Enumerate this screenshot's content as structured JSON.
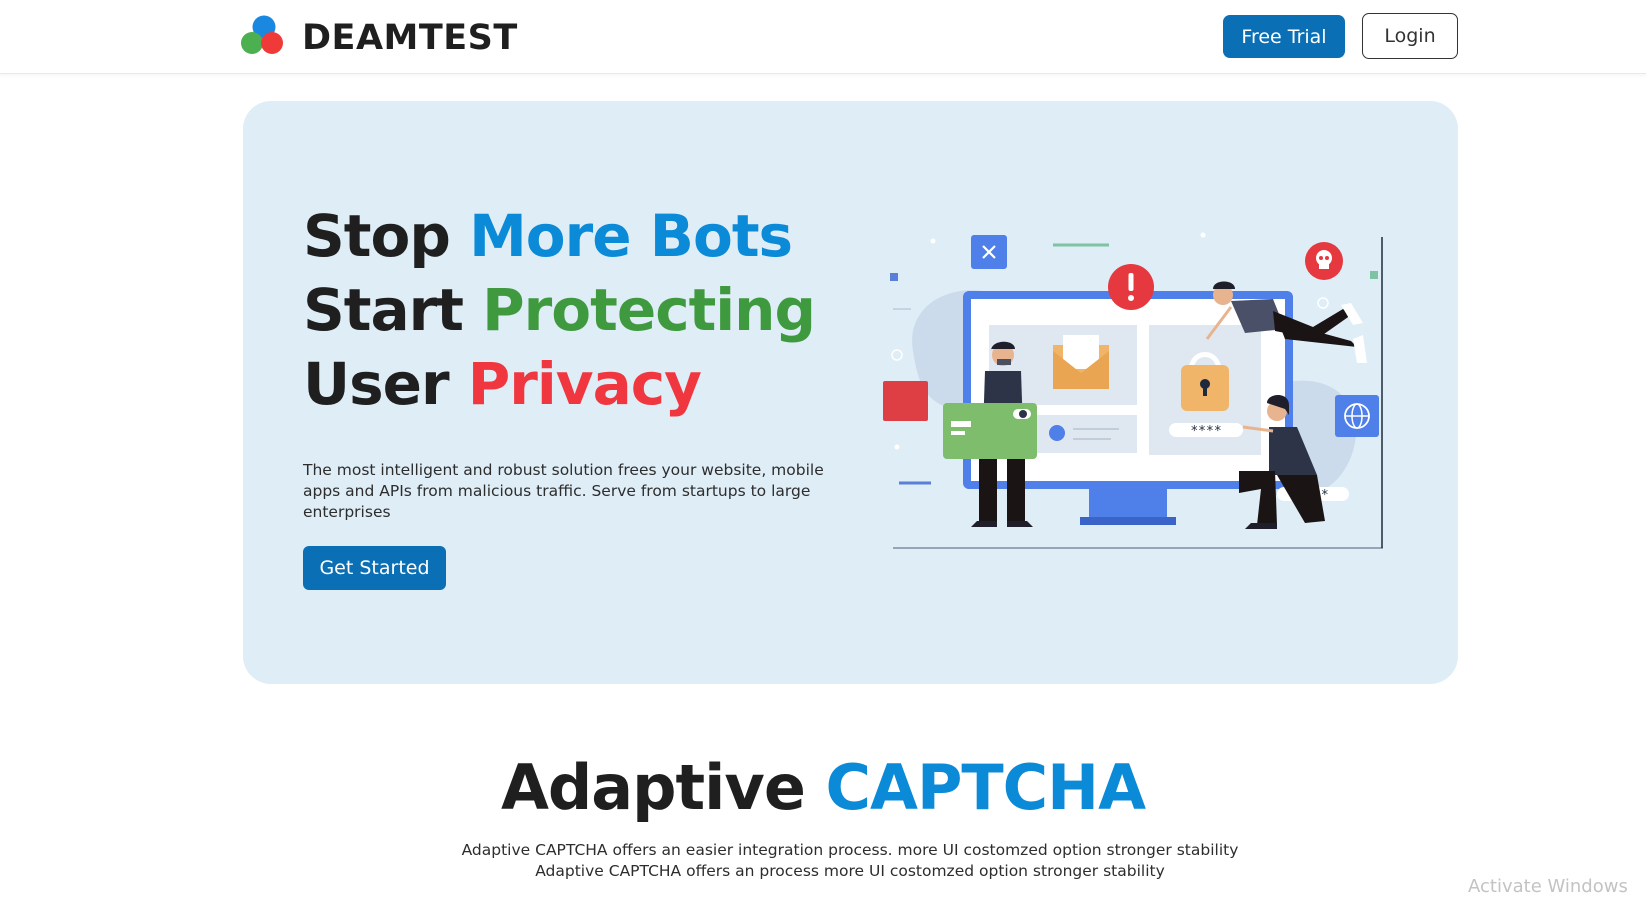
{
  "navbar": {
    "brand": "DEAMTEST",
    "free_trial_label": "Free Trial",
    "login_label": "Login"
  },
  "hero": {
    "headline": {
      "line1_prefix": "Stop ",
      "line1_highlight": "More Bots",
      "line2_prefix": "Start ",
      "line2_highlight": "Protecting",
      "line3_prefix": "User ",
      "line3_highlight": "Privacy"
    },
    "description": "The most intelligent and robust solution frees your website, mobile apps and APIs from malicious traffic. Serve from startups to large enterprises",
    "cta_label": "Get Started",
    "illustration": {
      "password_mask_1": "****",
      "password_mask_2": "****"
    }
  },
  "section": {
    "title_prefix": "Adaptive ",
    "title_highlight": "CAPTCHA",
    "description": "Adaptive CAPTCHA offers an easier integration process. more UI costomzed option stronger stability Adaptive CAPTCHA offers an process more UI costomzed option stronger stability"
  },
  "watermark": "Activate Windows",
  "colors": {
    "primary_button": "#0a6fb5",
    "hero_background": "#deedf6",
    "highlight_blue": "#0b8ad8",
    "highlight_green": "#3f9a3f",
    "highlight_red": "#f0373f"
  }
}
